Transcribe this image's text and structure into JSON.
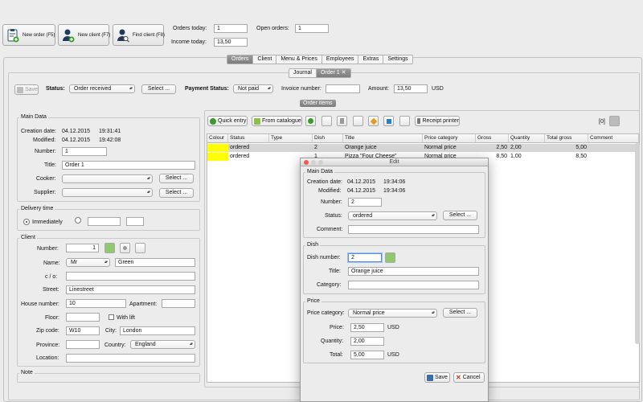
{
  "toolbar": {
    "new_order": "New order (F5)",
    "new_client": "New client (F7)",
    "find_client": "Find client (F8)",
    "orders_today_label": "Orders today:",
    "orders_today": "1",
    "open_orders_label": "Open orders:",
    "open_orders": "1",
    "income_today_label": "Income today:",
    "income_today": "13,50"
  },
  "main_tabs": [
    "Orders",
    "Client",
    "Menu & Prices",
    "Employees",
    "Extras",
    "Settings"
  ],
  "sub_tabs": {
    "journal": "Journal",
    "order": "Order 1"
  },
  "order_bar": {
    "save": "Save",
    "status_label": "Status:",
    "status_value": "Order received",
    "select": "Select ...",
    "payment_label": "Payment Status:",
    "payment_value": "Not paid",
    "invoice_label": "Invoice number:",
    "invoice_value": "",
    "amount_label": "Amount:",
    "amount_value": "13,50",
    "currency": "USD"
  },
  "main_data": {
    "title": "Main Data",
    "creation_label": "Creation date:",
    "creation_date": "04.12.2015",
    "creation_time": "19:31:41",
    "modified_label": "Modified:",
    "modified_date": "04.12.2015",
    "modified_time": "19:42:08",
    "number_label": "Number:",
    "number": "1",
    "title_label": "Title:",
    "title_value": "Order 1",
    "cooker_label": "Cooker:",
    "supplier_label": "Supplier:",
    "select": "Select ..."
  },
  "delivery": {
    "title": "Delivery time",
    "immediately": "Immediately"
  },
  "client": {
    "title": "Client",
    "number_label": "Number:",
    "number": "1",
    "name_label": "Name:",
    "salutation": "Mr",
    "name": "Green",
    "co_label": "c / o:",
    "street_label": "Street:",
    "street": "Linestreet",
    "house_label": "House number:",
    "house": "10",
    "apartment_label": "Apartment:",
    "floor_label": "Floor:",
    "lift_label": "With lift",
    "zip_label": "Zip code:",
    "zip": "W10",
    "city_label": "City:",
    "city": "London",
    "province_label": "Province:",
    "country_label": "Country:",
    "country": "England",
    "location_label": "Location:"
  },
  "note_title": "Note",
  "order_items": {
    "title": "Order items",
    "quick_entry": "Quick entry",
    "from_catalogue": "From catalogue",
    "receipt_printer": "Receipt printer",
    "count": "[0]",
    "columns": [
      "Colour",
      "Status",
      "Type",
      "Dish",
      "Title",
      "Price category",
      "Gross",
      "Quantity",
      "Total gross",
      "Comment"
    ],
    "rows": [
      {
        "status": "ordered",
        "type": "",
        "dish": "2",
        "title": "Orange juice",
        "category": "Normal price",
        "gross": "2,50",
        "quantity": "2,00",
        "total": "5,00",
        "comment": ""
      },
      {
        "status": "ordered",
        "type": "",
        "dish": "1",
        "title": "Pizza \"Four Cheese\"",
        "category": "Normal price",
        "gross": "8,50",
        "quantity": "1,00",
        "total": "8,50",
        "comment": ""
      }
    ]
  },
  "edit_dialog": {
    "title": "Edit",
    "main_data_title": "Main Data",
    "creation_label": "Creation date:",
    "creation_date": "04.12.2015",
    "creation_time": "19:34:06",
    "modified_label": "Modified:",
    "modified_date": "04.12.2015",
    "modified_time": "19:34:06",
    "number_label": "Number:",
    "number": "2",
    "status_label": "Status:",
    "status": "ordered",
    "comment_label": "Comment:",
    "select": "Select ...",
    "dish_title": "Dish",
    "dish_number_label": "Dish number:",
    "dish_number": "2",
    "title_label": "Title:",
    "title_value": "Orange juice",
    "category_label": "Category:",
    "price_title": "Price",
    "price_category_label": "Price category:",
    "price_category": "Normal price",
    "price_label": "Price:",
    "price": "2,50",
    "quantity_label": "Quantity:",
    "quantity": "2,00",
    "total_label": "Total:",
    "total": "5,00",
    "currency": "USD",
    "save": "Save",
    "cancel": "Cancel"
  },
  "colors": {
    "row_highlight": "#ffff00",
    "selected_row": "#d6d6d6",
    "accent_green": "#3c9a2a"
  }
}
